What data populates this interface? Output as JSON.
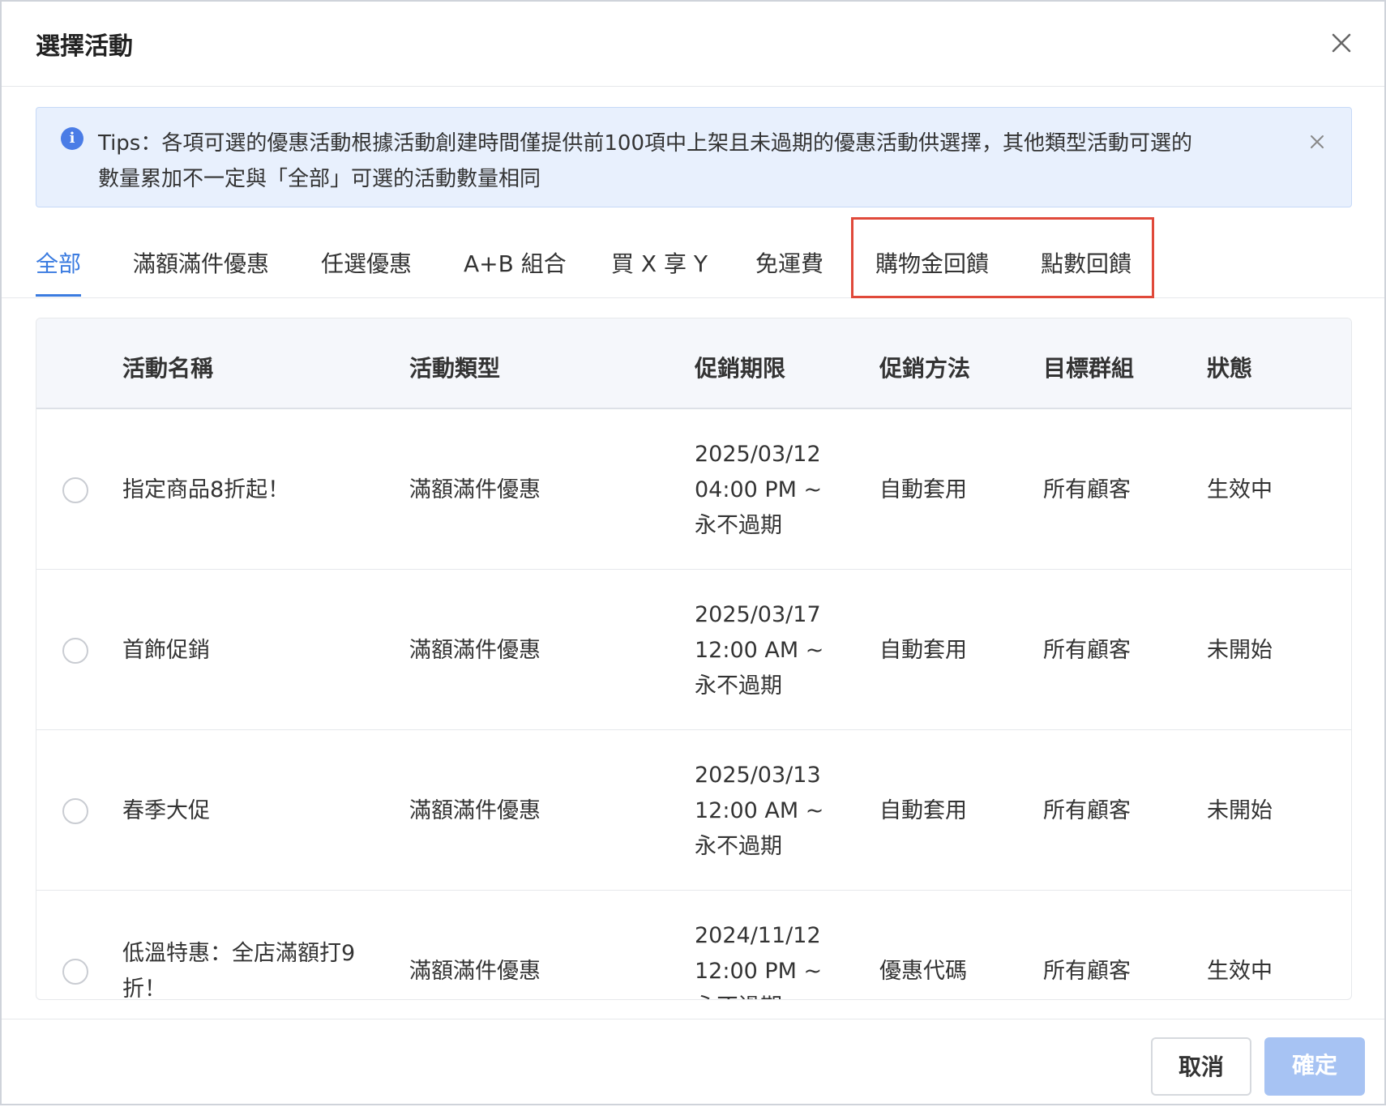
{
  "dialog": {
    "title": "選擇活動"
  },
  "tips": {
    "line1": "Tips：各項可選的優惠活動根據活動創建時間僅提供前100項中上架且未過期的優惠活動供選擇，其他類型活動可選的",
    "line2": "數量累加不一定與「全部」可選的活動數量相同"
  },
  "tabs": [
    {
      "label": "全部",
      "active": true
    },
    {
      "label": "滿額滿件優惠"
    },
    {
      "label": "任選優惠"
    },
    {
      "label": "A+B 組合"
    },
    {
      "label": "買 X 享 Y"
    },
    {
      "label": "免運費"
    },
    {
      "label": "購物金回饋"
    },
    {
      "label": "點數回饋"
    }
  ],
  "table": {
    "headers": [
      "活動名稱",
      "活動類型",
      "促銷期限",
      "促銷方法",
      "目標群組",
      "狀態"
    ],
    "rows": [
      {
        "name_l1": "指定商品8折起！",
        "name_l2": "",
        "type": "滿額滿件優惠",
        "period_l1": "2025/03/12",
        "period_l2": "04:00 PM ~",
        "period_l3": "永不過期",
        "method": "自動套用",
        "group": "所有顧客",
        "status": "生效中"
      },
      {
        "name_l1": "首飾促銷",
        "name_l2": "",
        "type": "滿額滿件優惠",
        "period_l1": "2025/03/17",
        "period_l2": "12:00 AM ~",
        "period_l3": "永不過期",
        "method": "自動套用",
        "group": "所有顧客",
        "status": "未開始"
      },
      {
        "name_l1": "春季大促",
        "name_l2": "",
        "type": "滿額滿件優惠",
        "period_l1": "2025/03/13",
        "period_l2": "12:00 AM ~",
        "period_l3": "永不過期",
        "method": "自動套用",
        "group": "所有顧客",
        "status": "未開始"
      },
      {
        "name_l1": "低溫特惠：全店滿額打9",
        "name_l2": "折！",
        "type": "滿額滿件優惠",
        "period_l1": "2024/11/12",
        "period_l2": "12:00 PM ~",
        "period_l3": "永不過期",
        "method": "優惠代碼",
        "group": "所有顧客",
        "status": "生效中"
      }
    ]
  },
  "footer": {
    "cancel_label": "取消",
    "confirm_label": "確定"
  },
  "colors": {
    "accent": "#3a7be0",
    "highlight": "#e0493a",
    "confirm_disabled": "#a7c3f3",
    "tips_bg": "#e8f0fd"
  }
}
